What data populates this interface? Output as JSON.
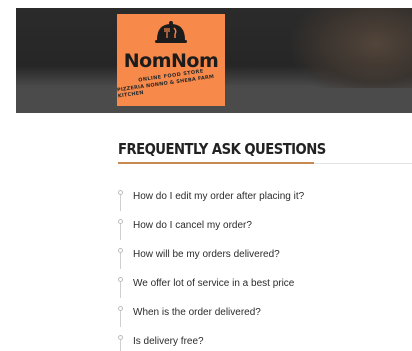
{
  "logo": {
    "name": "NomNom",
    "tagline": "Online Food Store",
    "tagline_secondary": "Pizzeria Nonno & Sheba Farm Kitchen",
    "color": "#f7894a"
  },
  "faq": {
    "title": "FREQUENTLY ASK QUESTIONS",
    "accent_color": "#c48a52",
    "questions": [
      "How do I edit my order after placing it?",
      "How do I cancel my order?",
      "How will be my orders delivered?",
      "We offer lot of service in a best price",
      "When is the order delivered?",
      "Is delivery free?"
    ]
  }
}
